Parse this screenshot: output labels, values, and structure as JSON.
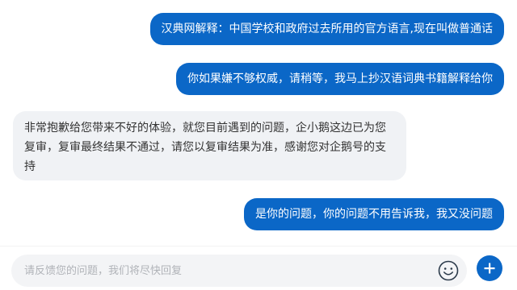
{
  "messages": [
    {
      "from": "user",
      "text": "汉典网解释：中国学校和政府过去所用的官方语言,现在叫做普通话"
    },
    {
      "from": "user",
      "text": "你如果嫌不够权威，请稍等，我马上抄汉语词典书籍解释给你"
    },
    {
      "from": "agent",
      "text": "非常抱歉给您带来不好的体验，就您目前遇到的问题，企小鹅这边已为您复审，复审最终结果不通过，请您以复审结果为准，感谢您对企鹅号的支持"
    },
    {
      "from": "user",
      "text": "是你的问题，你的问题不用告诉我，我又没问题"
    }
  ],
  "composer": {
    "placeholder": "请反馈您的问题，我们将尽快回复",
    "value": ""
  },
  "icons": {
    "emoji": "smiley-face-icon",
    "send": "plus-icon"
  },
  "colors": {
    "outgoing_bubble": "#0b67c7",
    "incoming_bubble": "#f0f2f5",
    "accent": "#0b67c7"
  }
}
